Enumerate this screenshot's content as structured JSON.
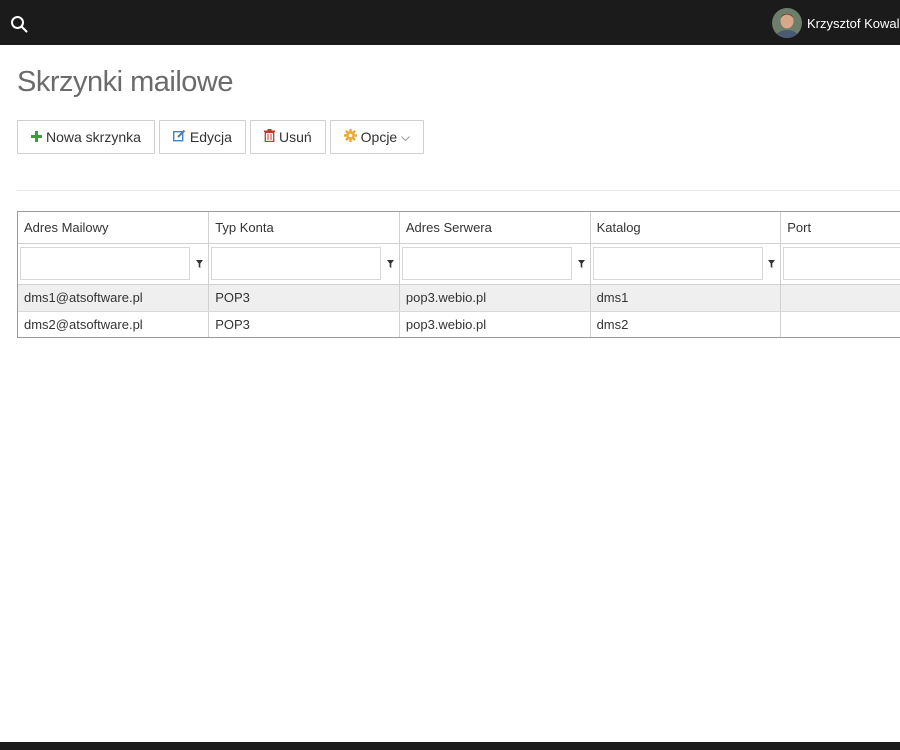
{
  "header": {
    "user_name": "Krzysztof Kowalski"
  },
  "page": {
    "title": "Skrzynki mailowe"
  },
  "toolbar": {
    "new_label": "Nowa skrzynka",
    "edit_label": "Edycja",
    "delete_label": "Usuń",
    "options_label": "Opcje"
  },
  "colors": {
    "topbar": "#1b1b1b",
    "new_icon": "#3aa03a",
    "edit_icon": "#3b86c8",
    "delete_icon": "#c0392b",
    "options_icon": "#f0a830"
  },
  "table": {
    "columns": [
      "Adres Mailowy",
      "Typ Konta",
      "Adres Serwera",
      "Katalog",
      "Port"
    ],
    "rows": [
      [
        "dms1@atsoftware.pl",
        "POP3",
        "pop3.webio.pl",
        "dms1",
        ""
      ],
      [
        "dms2@atsoftware.pl",
        "POP3",
        "pop3.webio.pl",
        "dms2",
        ""
      ]
    ]
  }
}
